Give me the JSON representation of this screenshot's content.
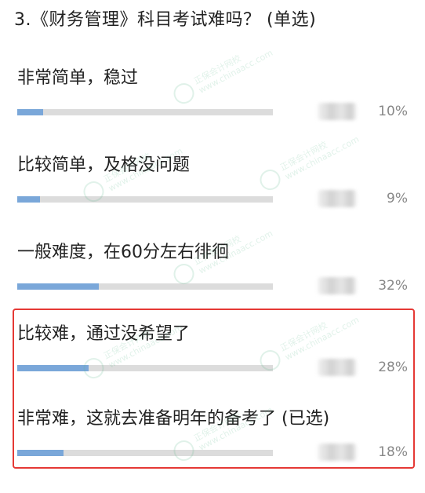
{
  "question": {
    "title": "3.《财务管理》科目考试难吗？ (单选)"
  },
  "options": [
    {
      "label": "非常简单，稳过",
      "percent": "10%",
      "fraction": 0.1
    },
    {
      "label": "比较简单，及格没问题",
      "percent": "9%",
      "fraction": 0.09
    },
    {
      "label": "一般难度，在60分左右徘徊",
      "percent": "32%",
      "fraction": 0.32
    },
    {
      "label": "比较难，通过没希望了",
      "percent": "28%",
      "fraction": 0.28
    },
    {
      "label": "非常难，这就去准备明年的备考了 (已选)",
      "percent": "18%",
      "fraction": 0.18
    }
  ],
  "watermark": {
    "line1": "正保会计网校",
    "line2": "www.chinaacc.com"
  },
  "colors": {
    "bar_fill": "#7aa7d9",
    "bar_track": "#dcdcdc",
    "highlight_border": "#e53935",
    "watermark": "#5ab88a"
  }
}
